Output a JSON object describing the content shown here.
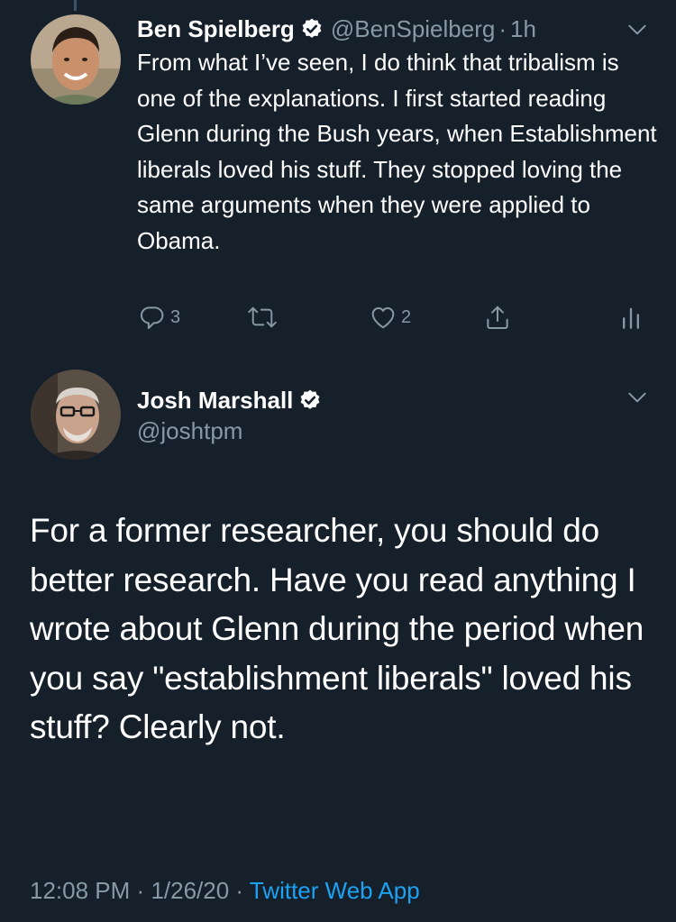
{
  "reply": {
    "display_name": "Ben Spielberg",
    "handle": "@BenSpielberg",
    "separator": "·",
    "time_ago": "1h",
    "text": "From what I’ve seen, I do think that tribalism is one of the explanations. I first started reading Glenn during the Bush years, when Establishment liberals loved his stuff. They stopped loving the same arguments when they were applied to Obama.",
    "reply_count": "3",
    "like_count": "2"
  },
  "main_tweet": {
    "display_name": "Josh Marshall",
    "handle": "@joshtpm",
    "text": "For a former researcher, you should do better research. Have you read anything I wrote about Glenn during the period when you say \"establishment liberals\" loved his stuff? Clearly not.",
    "time": "12:08 PM",
    "separator": "·",
    "date": "1/26/20",
    "source_separator": "·",
    "source": "Twitter Web App"
  },
  "icons": {
    "verified": "verified-badge-icon",
    "chevron": "chevron-down-icon",
    "reply": "reply-icon",
    "retweet": "retweet-icon",
    "like": "heart-icon",
    "share": "share-icon",
    "analytics": "analytics-icon"
  },
  "colors": {
    "background": "#15202b",
    "secondary_text": "#8899a6",
    "link": "#1da1f2",
    "thread_line": "#3d5466"
  }
}
